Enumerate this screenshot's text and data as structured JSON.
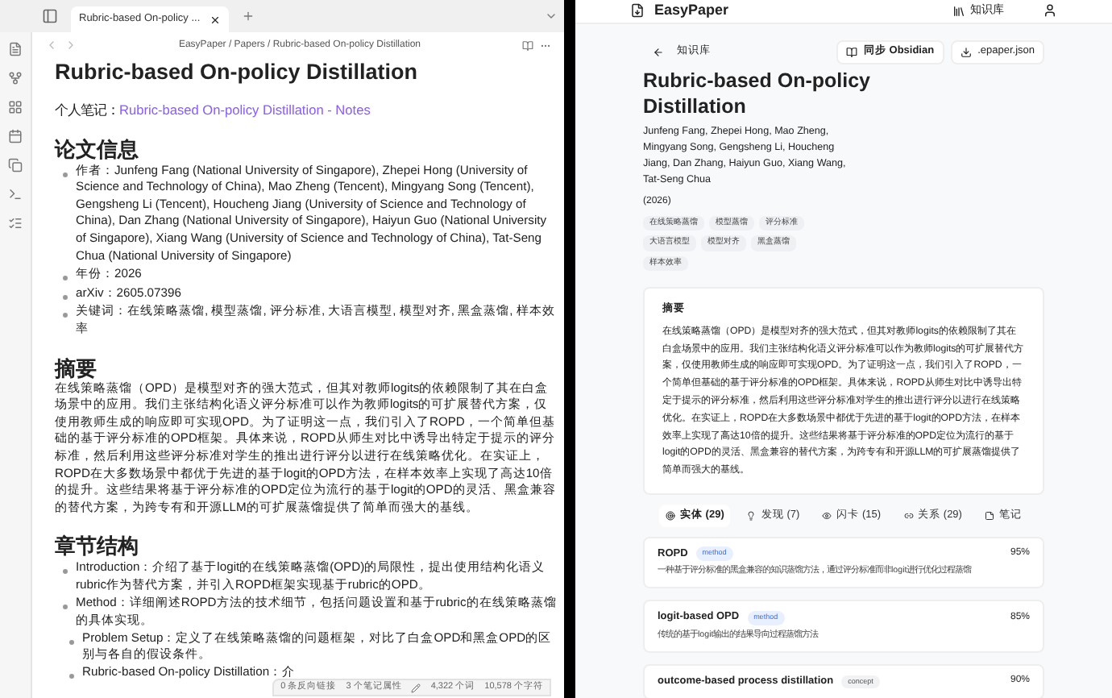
{
  "left": {
    "tab": {
      "title": "Rubric-based On-policy ...",
      "selected": true
    },
    "breadcrumb": "EasyPaper / Papers / Rubric-based On-policy Distillation",
    "title": "Rubric-based On-policy Distillation",
    "note_label": "个人笔记：",
    "note_link": "Rubric-based On-policy Distillation - Notes",
    "sections": [
      {
        "heading": "论文信息",
        "kind": "list",
        "items": [
          {
            "text": "作者：Junfeng Fang (National University of Singapore), Zhepei Hong (University of Science and Technology of China), Mao Zheng (Tencent), Mingyang Song (Tencent), Gengsheng Li (Tencent), Houcheng Jiang (University of Science and Technology of China), Dan Zhang (National University of Singapore), Haiyun Guo (National University of Singapore), Xiang Wang (University of Science and Technology of China), Tat-Seng Chua (National University of Singapore)"
          },
          {
            "text": "年份：2026"
          },
          {
            "text": "arXiv：2605.07396"
          },
          {
            "text": "关键词：在线策略蒸馏, 模型蒸馏, 评分标准, 大语言模型, 模型对齐, 黑盒蒸馏, 样本效率"
          }
        ]
      },
      {
        "heading": "摘要",
        "kind": "paragraph",
        "text": "在线策略蒸馏（OPD）是模型对齐的强大范式，但其对教师logits的依赖限制了其在白盒场景中的应用。我们主张结构化语义评分标准可以作为教师logits的可扩展替代方案，仅使用教师生成的响应即可实现OPD。为了证明这一点，我们引入了ROPD，一个简单但基础的基于评分标准的OPD框架。具体来说，ROPD从师生对比中诱导出特定于提示的评分标准，然后利用这些评分标准对学生的推出进行评分以进行在线策略优化。在实证上，ROPD在大多数场景中都优于先进的基于logit的OPD方法，在样本效率上实现了高达10倍的提升。这些结果将基于评分标准的OPD定位为流行的基于logit的OPD的灵活、黑盒兼容的替代方案，为跨专有和开源LLM的可扩展蒸馏提供了简单而强大的基线。"
      },
      {
        "heading": "章节结构",
        "kind": "list",
        "items": [
          {
            "text": "Introduction：介绍了基于logit的在线策略蒸馏(OPD)的局限性，提出使用结构化语义rubric作为替代方案，并引入ROPD框架实现基于rubric的OPD。"
          },
          {
            "text": "Method：详细阐述ROPD方法的技术细节，包括问题设置和基于rubric的在线策略蒸馏的具体实现。",
            "children": [
              {
                "text": "Problem Setup：定义了在线策略蒸馏的问题框架，对比了白盒OPD和黑盒OPD的区别与各自的假设条件。"
              },
              {
                "text": "Rubric-based On-policy Distillation：介"
              }
            ]
          }
        ]
      }
    ],
    "status": [
      "0 条反向链接",
      "3 个笔记属性",
      "4,322 个词",
      "10,578 个字符"
    ]
  },
  "right": {
    "brand": "EasyPaper",
    "nav": "知识库",
    "back": "知识库",
    "actions": [
      "同步 Obsidian",
      ".epaper.json"
    ],
    "title": "Rubric-based On-policy Distillation",
    "authors": "Junfeng Fang, Zhepei Hong, Mao Zheng, Mingyang Song, Gengsheng Li, Houcheng Jiang, Dan Zhang, Haiyun Guo, Xiang Wang, Tat-Seng Chua",
    "year": "(2026)",
    "tags": [
      "在线策略蒸馏",
      "模型蒸馏",
      "评分标准",
      "大语言模型",
      "模型对齐",
      "黑盒蒸馏",
      "样本效率"
    ],
    "abstract_title": "摘要",
    "abstract": "在线策略蒸馏（OPD）是模型对齐的强大范式，但其对教师logits的依赖限制了其在白盒场景中的应用。我们主张结构化语义评分标准可以作为教师logits的可扩展替代方案，仅使用教师生成的响应即可实现OPD。为了证明这一点，我们引入了ROPD，一个简单但基础的基于评分标准的OPD框架。具体来说，ROPD从师生对比中诱导出特定于提示的评分标准，然后利用这些评分标准对学生的推出进行评分以进行在线策略优化。在实证上，ROPD在大多数场景中都优于先进的基于logit的OPD方法，在样本效率上实现了高达10倍的提升。这些结果将基于评分标准的OPD定位为流行的基于logit的OPD的灵活、黑盒兼容的替代方案，为跨专有和开源LLM的可扩展蒸馏提供了简单而强大的基线。",
    "tabs": [
      {
        "label": "实体 (29)",
        "kind": "entity",
        "selected": true
      },
      {
        "label": "发现 (7)",
        "kind": "finding",
        "selected": false
      },
      {
        "label": "闪卡 (15)",
        "kind": "card",
        "selected": false
      },
      {
        "label": "关系 (29)",
        "kind": "relation",
        "selected": false
      },
      {
        "label": "笔记",
        "kind": "note",
        "selected": false
      }
    ],
    "entities": [
      {
        "name": "ROPD",
        "type": "method",
        "score": "95%",
        "desc": "一种基于评分标准的黑盒兼容的知识蒸馏方法，通过评分标准而非logit进行优化过程蒸馏"
      },
      {
        "name": "logit-based OPD",
        "type": "method",
        "score": "85%",
        "desc": "传统的基于logit输出的结果导向过程蒸馏方法"
      },
      {
        "name": "outcome-based process distillation",
        "type": "concept",
        "score": "90%"
      }
    ]
  }
}
